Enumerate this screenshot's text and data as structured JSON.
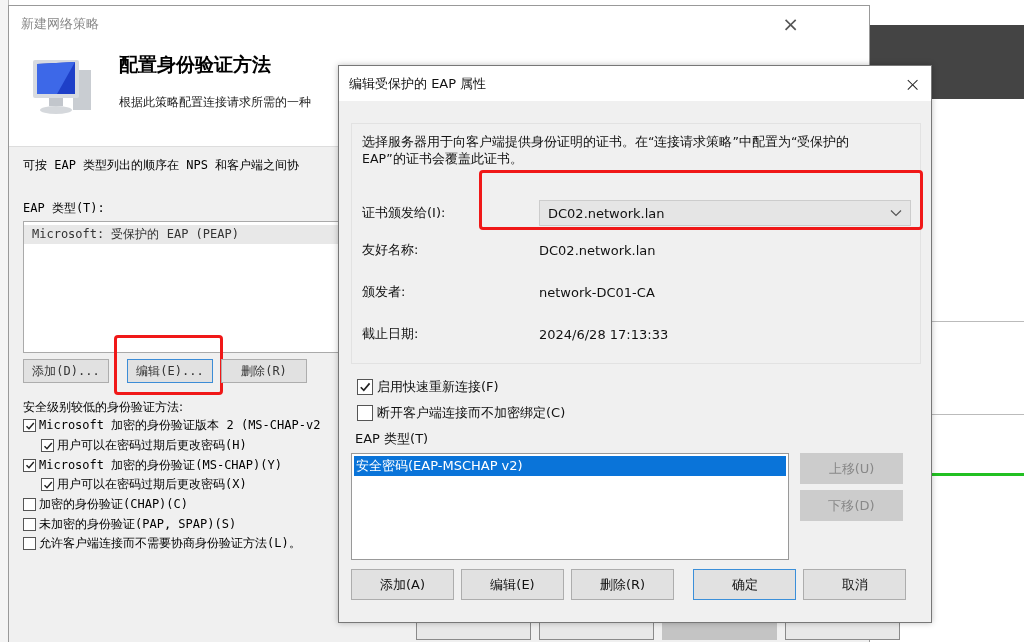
{
  "wizard": {
    "title": "新建网络策略",
    "close": "×",
    "heading": "配置身份验证方法",
    "subtitle": "根据此策略配置连接请求所需的一种",
    "intro": "可按 EAP 类型列出的顺序在 NPS 和客户端之间协",
    "eap_label": "EAP 类型(T):",
    "eap_types": [
      {
        "label": "Microsoft: 受保护的 EAP (PEAP)",
        "selected": true
      }
    ],
    "eap_buttons": [
      {
        "label": "添加(D)...",
        "focused": false,
        "highlighted": false
      },
      {
        "label": "编辑(E)...",
        "focused": true,
        "highlighted": true
      },
      {
        "label": "删除(R)",
        "focused": false,
        "highlighted": false
      }
    ],
    "methods_label": "安全级别较低的身份验证方法:",
    "methods": [
      {
        "label": "Microsoft 加密的身份验证版本 2 (MS-CHAP-v2",
        "checked": true,
        "children": [
          {
            "label": "用户可以在密码过期后更改密码(H)",
            "checked": true
          }
        ]
      },
      {
        "label": "Microsoft 加密的身份验证(MS-CHAP)(Y)",
        "checked": true,
        "children": [
          {
            "label": "用户可以在密码过期后更改密码(X)",
            "checked": true
          }
        ]
      },
      {
        "label": "加密的身份验证(CHAP)(C)",
        "checked": false
      },
      {
        "label": "未加密的身份验证(PAP, SPAP)(S)",
        "checked": false
      },
      {
        "label": "允许客户端连接而不需要协商身份验证方法(L)。",
        "checked": false
      }
    ],
    "nav_buttons": [
      {
        "disabled": false
      },
      {
        "disabled": false
      },
      {
        "disabled": true
      },
      {
        "disabled": false
      }
    ]
  },
  "dialog": {
    "title": "编辑受保护的 EAP 属性",
    "close": "×",
    "description": "选择服务器用于向客户端提供身份证明的证书。在“连接请求策略”中配置为“受保护的 EAP”的证书会覆盖此证书。",
    "certificate": {
      "label": "证书颁发给(I):",
      "value": "DC02.network.lan",
      "highlighted": true
    },
    "details": [
      {
        "label": "友好名称:",
        "value": "DC02.network.lan"
      },
      {
        "label": "颁发者:",
        "value": "network-DC01-CA"
      },
      {
        "label": "截止日期:",
        "value": "2024/6/28 17:13:33"
      }
    ],
    "options": [
      {
        "label": "启用快速重新连接(F)",
        "checked": true
      },
      {
        "label": "断开客户端连接而不加密绑定(C)",
        "checked": false
      }
    ],
    "eap_label": "EAP 类型(T)",
    "eap_types": [
      {
        "label": "安全密码(EAP-MSCHAP v2)",
        "selected": true
      }
    ],
    "move_buttons": [
      {
        "label": "上移(U)",
        "disabled": true
      },
      {
        "label": "下移(D)",
        "disabled": true
      }
    ],
    "buttons": [
      {
        "label": "添加(A)",
        "default": false
      },
      {
        "label": "编辑(E)",
        "default": false
      },
      {
        "label": "删除(R)",
        "default": false
      },
      {
        "label": "确定",
        "default": true
      },
      {
        "label": "取消",
        "default": false
      }
    ]
  }
}
